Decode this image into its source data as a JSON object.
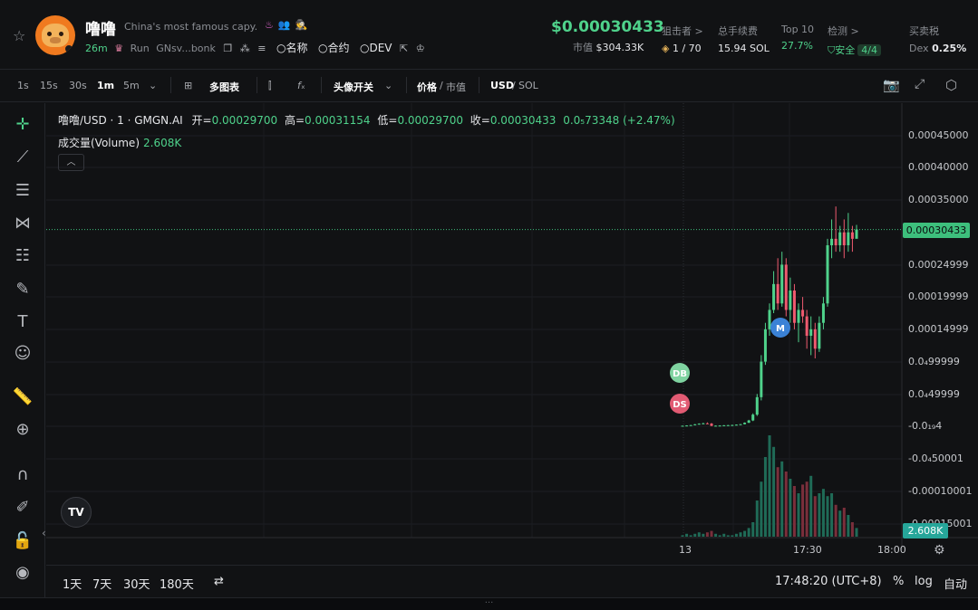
{
  "token": {
    "name": "噜噜",
    "description": "China's most famous capy...",
    "age": "26m",
    "platform": "Run",
    "address": "GNsv...bonk",
    "links": [
      "名称",
      "合约",
      "DEV"
    ]
  },
  "price": {
    "value": "$0.00030433",
    "mcap_label": "市值",
    "mcap_value": "$304.33K"
  },
  "stats": {
    "snipers_label": "狙击者 >",
    "snipers_value": "1 / 70",
    "fees_label": "总手续费",
    "fees_value": "15.94 SOL",
    "top10_label": "Top 10",
    "top10_value": "27.7%",
    "check_label": "检测 >",
    "check_value": "安全",
    "check_badge": "4/4",
    "tax_label": "买卖税",
    "tax_prefix": "Dex",
    "tax_value": "0.25%"
  },
  "toolbar": {
    "intervals": [
      "1s",
      "15s",
      "30s",
      "1m",
      "5m"
    ],
    "active_interval": "1m",
    "multi_chart": "多图表",
    "avatar_toggle": "头像开关",
    "price": "价格",
    "mcap": "市值",
    "usd": "USD",
    "sol": "SOL"
  },
  "legend": {
    "symbol": "噜噜/USD · 1 · GMGN.AI",
    "open_label": "开=",
    "open": "0.00029700",
    "high_label": "高=",
    "high": "0.00031154",
    "low_label": "低=",
    "low": "0.00029700",
    "close_label": "收=",
    "close": "0.00030433",
    "change": "0.0₅73348 (+2.47%)",
    "volume_label": "成交量(Volume)",
    "volume": "2.608K"
  },
  "axis": {
    "y_labels": [
      "0.00045000",
      "0.00040000",
      "0.00035000",
      "0.00024999",
      "0.00019999",
      "0.00014999",
      "0.0₄99999",
      "0.0₄49999",
      "-0.0₁₉4",
      "-0.0₄50001",
      "-0.00010001",
      "-0.00015001"
    ],
    "current_price_tag": "0.00030433",
    "volume_tag": "2.608K",
    "x_labels": [
      "13",
      "17:30",
      "18:00"
    ]
  },
  "markers": {
    "db": "DB",
    "ds": "DS",
    "m": "M"
  },
  "bottom": {
    "ranges": [
      "1天",
      "7天",
      "30天",
      "180天"
    ],
    "time": "17:48:20 (UTC+8)",
    "percent": "%",
    "log": "log",
    "auto": "自动"
  },
  "colors": {
    "up": "#4fd28b",
    "down": "#ef5a6f",
    "vol_up": "#1f6b57",
    "vol_down": "#7a2f3b"
  },
  "chart_data": {
    "type": "candlestick",
    "candles": [
      [
        5e-07,
        1e-06,
        2e-07,
        8e-07
      ],
      [
        8e-07,
        1.5e-06,
        4e-07,
        1.2e-06
      ],
      [
        1.2e-06,
        2e-06,
        9e-07,
        1.8e-06
      ],
      [
        1.8e-06,
        3.5e-06,
        1.5e-06,
        3e-06
      ],
      [
        3e-06,
        4.5e-06,
        2.5e-06,
        4e-06
      ],
      [
        4e-06,
        5.5e-06,
        3.5e-06,
        4.5e-06
      ],
      [
        4.5e-06,
        6e-06,
        4e-06,
        4.2e-06
      ],
      [
        4.2e-06,
        5e-06,
        2e-07,
        6e-07
      ],
      [
        6e-07,
        1.2e-06,
        2e-07,
        9e-07
      ],
      [
        9e-07,
        1.5e-06,
        5e-07,
        1.1e-06
      ],
      [
        1.1e-06,
        1.8e-06,
        8e-07,
        1.5e-06
      ],
      [
        1.5e-06,
        2e-06,
        1.1e-06,
        1.7e-06
      ],
      [
        1.7e-06,
        2.5e-06,
        1.4e-06,
        1.9e-06
      ],
      [
        1.9e-06,
        2.8e-06,
        1.5e-06,
        2.5e-06
      ],
      [
        2.5e-06,
        3.5e-06,
        2e-06,
        3.2e-06
      ],
      [
        3.2e-06,
        6e-06,
        3e-06,
        5.5e-06
      ],
      [
        5.5e-06,
        1e-05,
        5e-06,
        9e-06
      ],
      [
        9e-06,
        2e-05,
        8e-06,
        1.8e-05
      ],
      [
        1.8e-05,
        5e-05,
        1.6e-05,
        4.5e-05
      ],
      [
        4.5e-05,
        0.00011,
        4e-05,
        0.0001
      ],
      [
        0.0001,
        0.00016,
        9.5e-05,
        0.00015
      ],
      [
        0.00015,
        0.00019,
        0.00014,
        0.00018
      ],
      [
        0.00018,
        0.00024,
        0.000175,
        0.00022
      ],
      [
        0.00022,
        0.00026,
        0.00018,
        0.00019
      ],
      [
        0.00019,
        0.00027,
        0.000185,
        0.00025
      ],
      [
        0.00025,
        0.00026,
        0.00017,
        0.00018
      ],
      [
        0.00018,
        0.00023,
        0.00016,
        0.00021
      ],
      [
        0.00021,
        0.00022,
        0.00015,
        0.00016
      ],
      [
        0.00016,
        0.00019,
        0.00013,
        0.00018
      ],
      [
        0.00018,
        0.0002,
        0.00016,
        0.00017
      ],
      [
        0.00017,
        0.00018,
        0.00012,
        0.00014
      ],
      [
        0.00014,
        0.00017,
        0.00011,
        0.00015
      ],
      [
        0.00015,
        0.00016,
        0.000105,
        0.00012
      ],
      [
        0.00012,
        0.00017,
        0.000115,
        0.00016
      ],
      [
        0.00016,
        0.0002,
        0.00015,
        0.00019
      ],
      [
        0.00019,
        0.00029,
        0.000185,
        0.00028
      ],
      [
        0.00028,
        0.00032,
        0.00026,
        0.00029
      ],
      [
        0.00029,
        0.00034,
        0.00027,
        0.00028
      ],
      [
        0.00028,
        0.00031,
        0.00027,
        0.0003
      ],
      [
        0.0003,
        0.00032,
        0.00026,
        0.00028
      ],
      [
        0.00028,
        0.00033,
        0.00027,
        0.0003
      ],
      [
        0.0003,
        0.00031,
        0.00027,
        0.00029
      ],
      [
        0.00029,
        0.0003115,
        0.000297,
        0.00030433
      ]
    ],
    "volumes": [
      1,
      2,
      1,
      2,
      3,
      2,
      3,
      4,
      2,
      1,
      2,
      1,
      1,
      2,
      3,
      4,
      6,
      10,
      25,
      38,
      55,
      70,
      62,
      48,
      52,
      45,
      40,
      35,
      30,
      36,
      38,
      42,
      28,
      30,
      33,
      28,
      30,
      22,
      18,
      20,
      15,
      10,
      6
    ],
    "ylim": [
      -0.00016,
      0.00046
    ]
  }
}
